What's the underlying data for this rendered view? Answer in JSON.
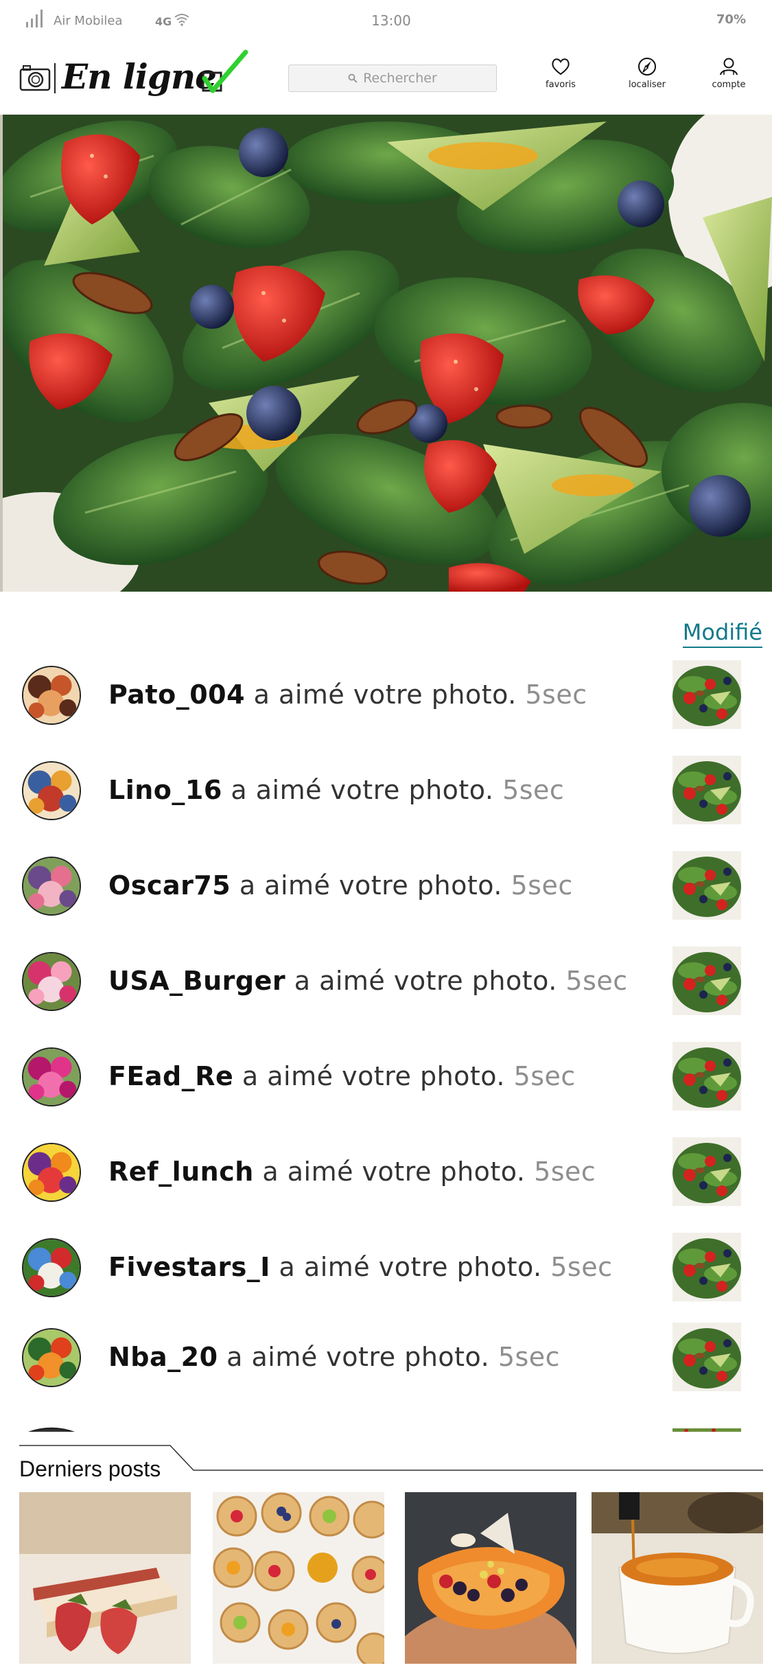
{
  "status_bar": {
    "carrier": "Air Mobilea",
    "network": "4G",
    "time": "13:00",
    "battery": "70%"
  },
  "header": {
    "brand": "En ligne",
    "search_placeholder": "Rechercher",
    "buttons": [
      {
        "label": "favoris",
        "icon": "heart-icon"
      },
      {
        "label": "localiser",
        "icon": "compass-icon"
      },
      {
        "label": "compte",
        "icon": "user-icon"
      }
    ]
  },
  "modified_label": "Modifié",
  "notifications": [
    {
      "user": "Pato_004",
      "text": "a aimé votre photo.",
      "time": "5sec"
    },
    {
      "user": "Lino_16",
      "text": "a aimé votre photo.",
      "time": "5sec"
    },
    {
      "user": "Oscar75",
      "text": "a aimé votre photo.",
      "time": "5sec"
    },
    {
      "user": "USA_Burger",
      "text": "a aimé votre photo.",
      "time": "5sec"
    },
    {
      "user": "FEad_Re",
      "text": "a aimé votre photo.",
      "time": "5sec"
    },
    {
      "user": "Ref_lunch",
      "text": "a aimé votre photo.",
      "time": "5sec"
    },
    {
      "user": "Fivestars_I",
      "text": "a aimé votre photo.",
      "time": "5sec"
    },
    {
      "user": "Nba_20",
      "text": "a aimé votre photo.",
      "time": "5sec"
    }
  ],
  "posts_section": {
    "title": "Derniers posts"
  },
  "colors": {
    "accent_teal": "#117a8a",
    "check_green": "#2fd12f",
    "muted_text": "#8e8e8e"
  }
}
